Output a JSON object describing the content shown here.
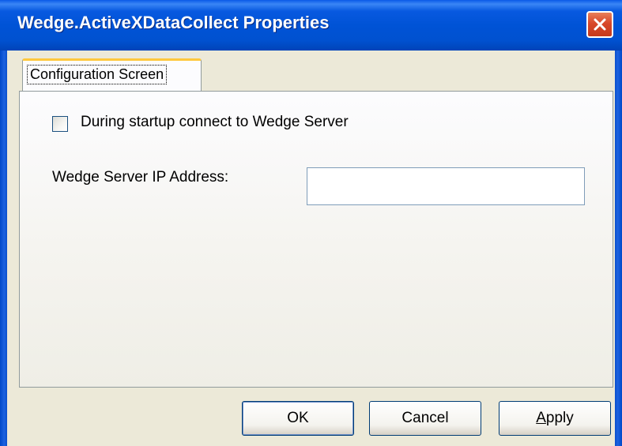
{
  "window": {
    "title": "Wedge.ActiveXDataCollect Properties",
    "close_icon": "close-x-icon",
    "title_bar_color": "#0053d6",
    "close_button_color": "#d8482a"
  },
  "tabs": [
    {
      "label": "Configuration Screen",
      "selected": true
    }
  ],
  "form": {
    "startup_checkbox": {
      "label": "During startup connect to Wedge Server",
      "checked": false
    },
    "ip_address": {
      "label": "Wedge Server IP Address:",
      "value": "",
      "placeholder": ""
    }
  },
  "buttons": {
    "ok": "OK",
    "cancel": "Cancel",
    "apply": "Apply"
  }
}
